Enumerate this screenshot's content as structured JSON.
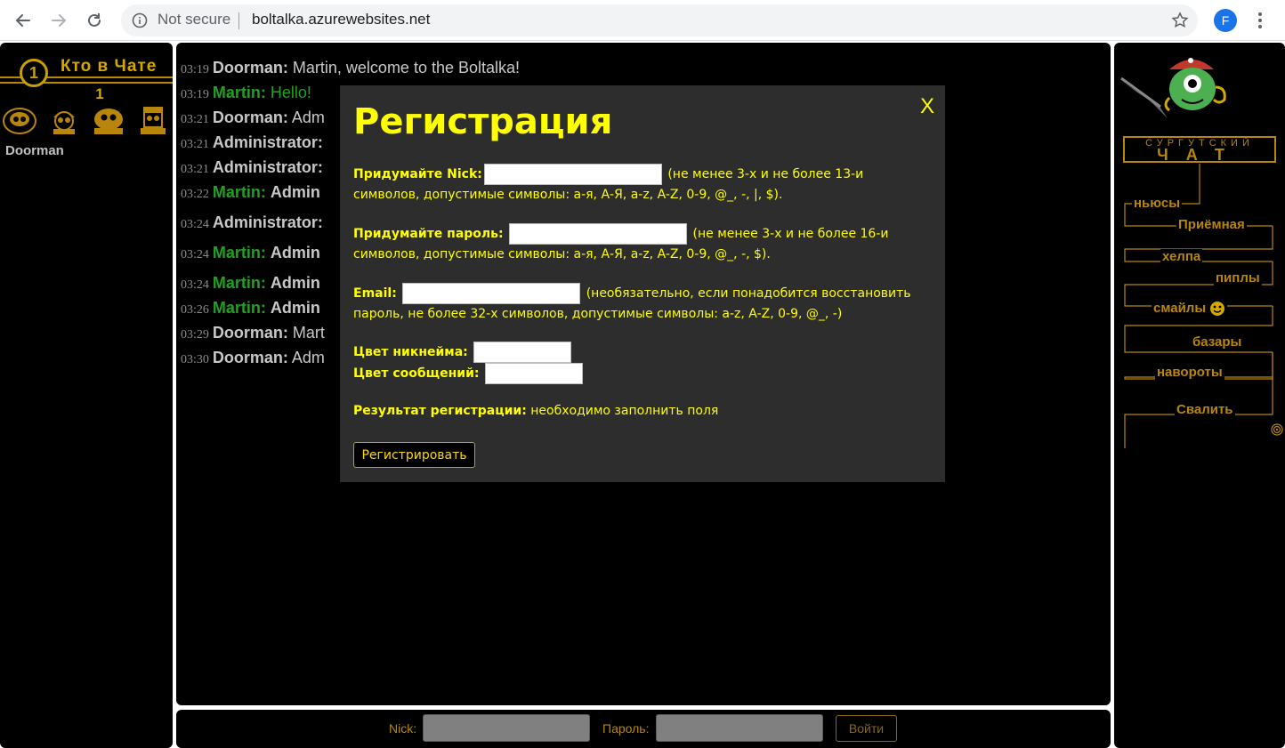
{
  "browser": {
    "security_label": "Not secure",
    "url": "boltalka.azurewebsites.net",
    "profile_initial": "F"
  },
  "left_panel": {
    "title": "Кто в Чате",
    "badge": "1",
    "count": "1",
    "users": [
      "Doorman"
    ]
  },
  "chat": {
    "messages": [
      {
        "time": "03:19",
        "nick": "Doorman:",
        "text": "Martin, welcome to the Boltalka!",
        "color": "gray"
      },
      {
        "time": "03:19",
        "nick": "Martin:",
        "text": "Hello!",
        "color": "green"
      },
      {
        "time": "03:21",
        "nick": "Doorman:",
        "text": "Adm",
        "color": "gray"
      },
      {
        "time": "03:21",
        "nick": "Administrator:",
        "text": "",
        "color": "gray"
      },
      {
        "time": "03:21",
        "nick": "Administrator:",
        "text": "",
        "color": "gray"
      },
      {
        "time": "03:22",
        "nick": "Martin:",
        "text": "Admin",
        "color": "green"
      },
      {
        "time": "03:24",
        "nick": "Administrator:",
        "text": "",
        "color": "gray"
      },
      {
        "time": "03:24",
        "nick": "Martin:",
        "text": "Admin",
        "color": "green"
      },
      {
        "time": "03:24",
        "nick": "Martin:",
        "text": "Admin",
        "color": "green"
      },
      {
        "time": "03:26",
        "nick": "Martin:",
        "text": "Admin",
        "color": "green"
      },
      {
        "time": "03:29",
        "nick": "Doorman:",
        "text": "Mart",
        "color": "gray"
      },
      {
        "time": "03:30",
        "nick": "Doorman:",
        "text": "Adm",
        "color": "gray"
      }
    ]
  },
  "login": {
    "nick_label": "Nick:",
    "password_label": "Пароль:",
    "submit_label": "Войти"
  },
  "right_panel": {
    "logo_top": "СУРГУТСКИЙ",
    "logo_bottom": "ЧАТ",
    "menu": [
      "ньюсы",
      "Приёмная",
      "хелпа",
      "пиплы",
      "смайлы",
      "базары",
      "навороты",
      "Свалить"
    ]
  },
  "modal": {
    "title": "Регистрация",
    "close_label": "X",
    "nick_label": "Придумайте Nick:",
    "nick_hint": "(не менее 3-х и не более 13-и символов, допустимые символы: а-я, А-Я, a-z, A-Z, 0-9, @_, -, |, $).",
    "password_label": "Придумайте пароль:",
    "password_hint": "(не менее 3-х и не более 16-и символов, допустимые символы: а-я, А-Я, a-z, A-Z, 0-9, @_, -, $).",
    "email_label": "Email:",
    "email_hint": "(необязательно, если понадобится восстановить пароль, не более 32-х символов, допустимые символы: a-z, A-Z, 0-9, @_, -)",
    "nick_color_label": "Цвет никнейма:",
    "msg_color_label": "Цвет сообщений:",
    "result_label": "Результат регистрации:",
    "result_text": "необходимо заполнить поля",
    "register_label": "Регистрировать"
  },
  "colors": {
    "accent_yellow": "#ffff00",
    "gold": "#b8860b",
    "modal_bg": "#2d2d2d",
    "nick_green": "#22a022"
  },
  "icons": [
    "back-arrow-icon",
    "forward-arrow-icon",
    "reload-icon",
    "info-icon",
    "star-icon",
    "kebab-menu-icon",
    "close-icon",
    "smiley-icon",
    "spiral-icon"
  ]
}
